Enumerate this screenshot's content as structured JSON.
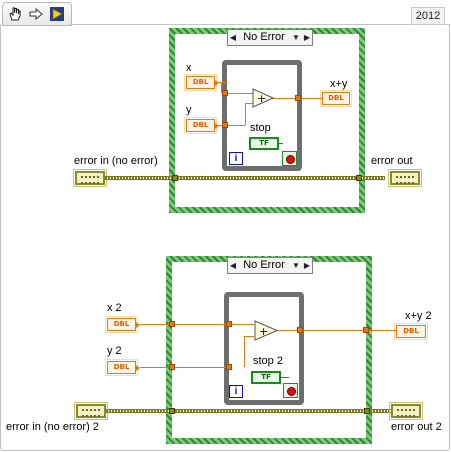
{
  "version": "2012",
  "toolbar": {
    "icons": [
      "hand-pointer-icon",
      "arrow-right-icon",
      "run-arrow-icon"
    ]
  },
  "colors": {
    "case_border": "#3d9a3d",
    "numeric_wire": "#e07a16",
    "error_wire": "#7a7a1a",
    "loop_border": "#6e6e6e",
    "boolean": "#1a8a1a"
  },
  "case1": {
    "selector": "No Error",
    "x_label": "x",
    "y_label": "y",
    "sum_label": "x+y",
    "stop_label": "stop",
    "x_type": "DBL",
    "y_type": "DBL",
    "sum_type": "DBL",
    "stop_type": "TF",
    "iter": "i",
    "op": "+"
  },
  "case2": {
    "selector": "No Error",
    "x_label": "x 2",
    "y_label": "y 2",
    "sum_label": "x+y 2",
    "stop_label": "stop 2",
    "x_type": "DBL",
    "y_type": "DBL",
    "sum_type": "DBL",
    "stop_type": "TF",
    "iter": "i",
    "op": "+"
  },
  "error": {
    "in1": "error in (no error)",
    "out1": "error out",
    "in2": "error in (no error) 2",
    "out2": "error out 2"
  }
}
